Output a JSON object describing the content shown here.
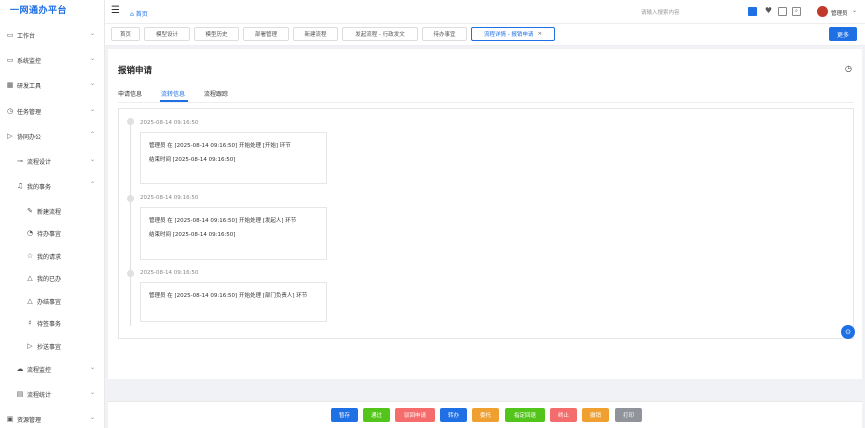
{
  "app_title": "一网通办平台",
  "topbar": {
    "home_label": "首页",
    "search_placeholder": "请输入搜索内容",
    "user_name": "管理员"
  },
  "sidebar": {
    "items": [
      {
        "label": "工作台"
      },
      {
        "label": "系统监控"
      },
      {
        "label": "研发工具"
      },
      {
        "label": "任务管理"
      },
      {
        "label": "协同办公"
      },
      {
        "label": "流程设计"
      },
      {
        "label": "我的事务"
      },
      {
        "label": "新建流程"
      },
      {
        "label": "待办事宜"
      },
      {
        "label": "我的请求"
      },
      {
        "label": "我的已办"
      },
      {
        "label": "办结事宜"
      },
      {
        "label": "待签事务"
      },
      {
        "label": "抄送事宜"
      },
      {
        "label": "流程监控"
      },
      {
        "label": "流程统计"
      },
      {
        "label": "资源管理"
      }
    ]
  },
  "tabs": [
    {
      "label": "首页"
    },
    {
      "label": "模型设计"
    },
    {
      "label": "模型历史"
    },
    {
      "label": "部署管理"
    },
    {
      "label": "新建流程"
    },
    {
      "label": "发起流程 - 行政发文"
    },
    {
      "label": "待办事宜"
    },
    {
      "label": "流程详情 - 报销申请",
      "close": "×"
    }
  ],
  "more_label": "更多",
  "page": {
    "title": "报销申请",
    "subtabs": [
      {
        "label": "申请信息"
      },
      {
        "label": "流转信息"
      },
      {
        "label": "流程跟踪"
      }
    ]
  },
  "timeline": [
    {
      "time": "2025-08-14 09:16:50",
      "line1": "管理员 在 [2025-08-14 09:16:50] 开始处理 [开始] 环节",
      "line2": "结束时间 [2025-08-14 09:16:50]"
    },
    {
      "time": "2025-08-14 09:16:50",
      "line1": "管理员 在 [2025-08-14 09:16:50] 开始处理 [发起人] 环节",
      "line2": "结束时间 [2025-08-14 09:16:50]"
    },
    {
      "time": "2025-08-14 09:16:50",
      "line1": "管理员 在 [2025-08-14 09:16:50] 开始处理 [部门负责人] 环节"
    }
  ],
  "actions": [
    {
      "label": "暂存",
      "color": "#1f6fe5"
    },
    {
      "label": "通过",
      "color": "#52c41a"
    },
    {
      "label": "驳回申请",
      "color": "#f56c6c"
    },
    {
      "label": "转办",
      "color": "#1f6fe5"
    },
    {
      "label": "委托",
      "color": "#f0a030"
    },
    {
      "label": "指定回退",
      "color": "#52c41a"
    },
    {
      "label": "终止",
      "color": "#f56c6c"
    },
    {
      "label": "撤销",
      "color": "#f0a030"
    },
    {
      "label": "打印",
      "color": "#909399"
    }
  ],
  "colors": {
    "accent": "#1f6fe5",
    "brand_logo": "#c0392b"
  }
}
